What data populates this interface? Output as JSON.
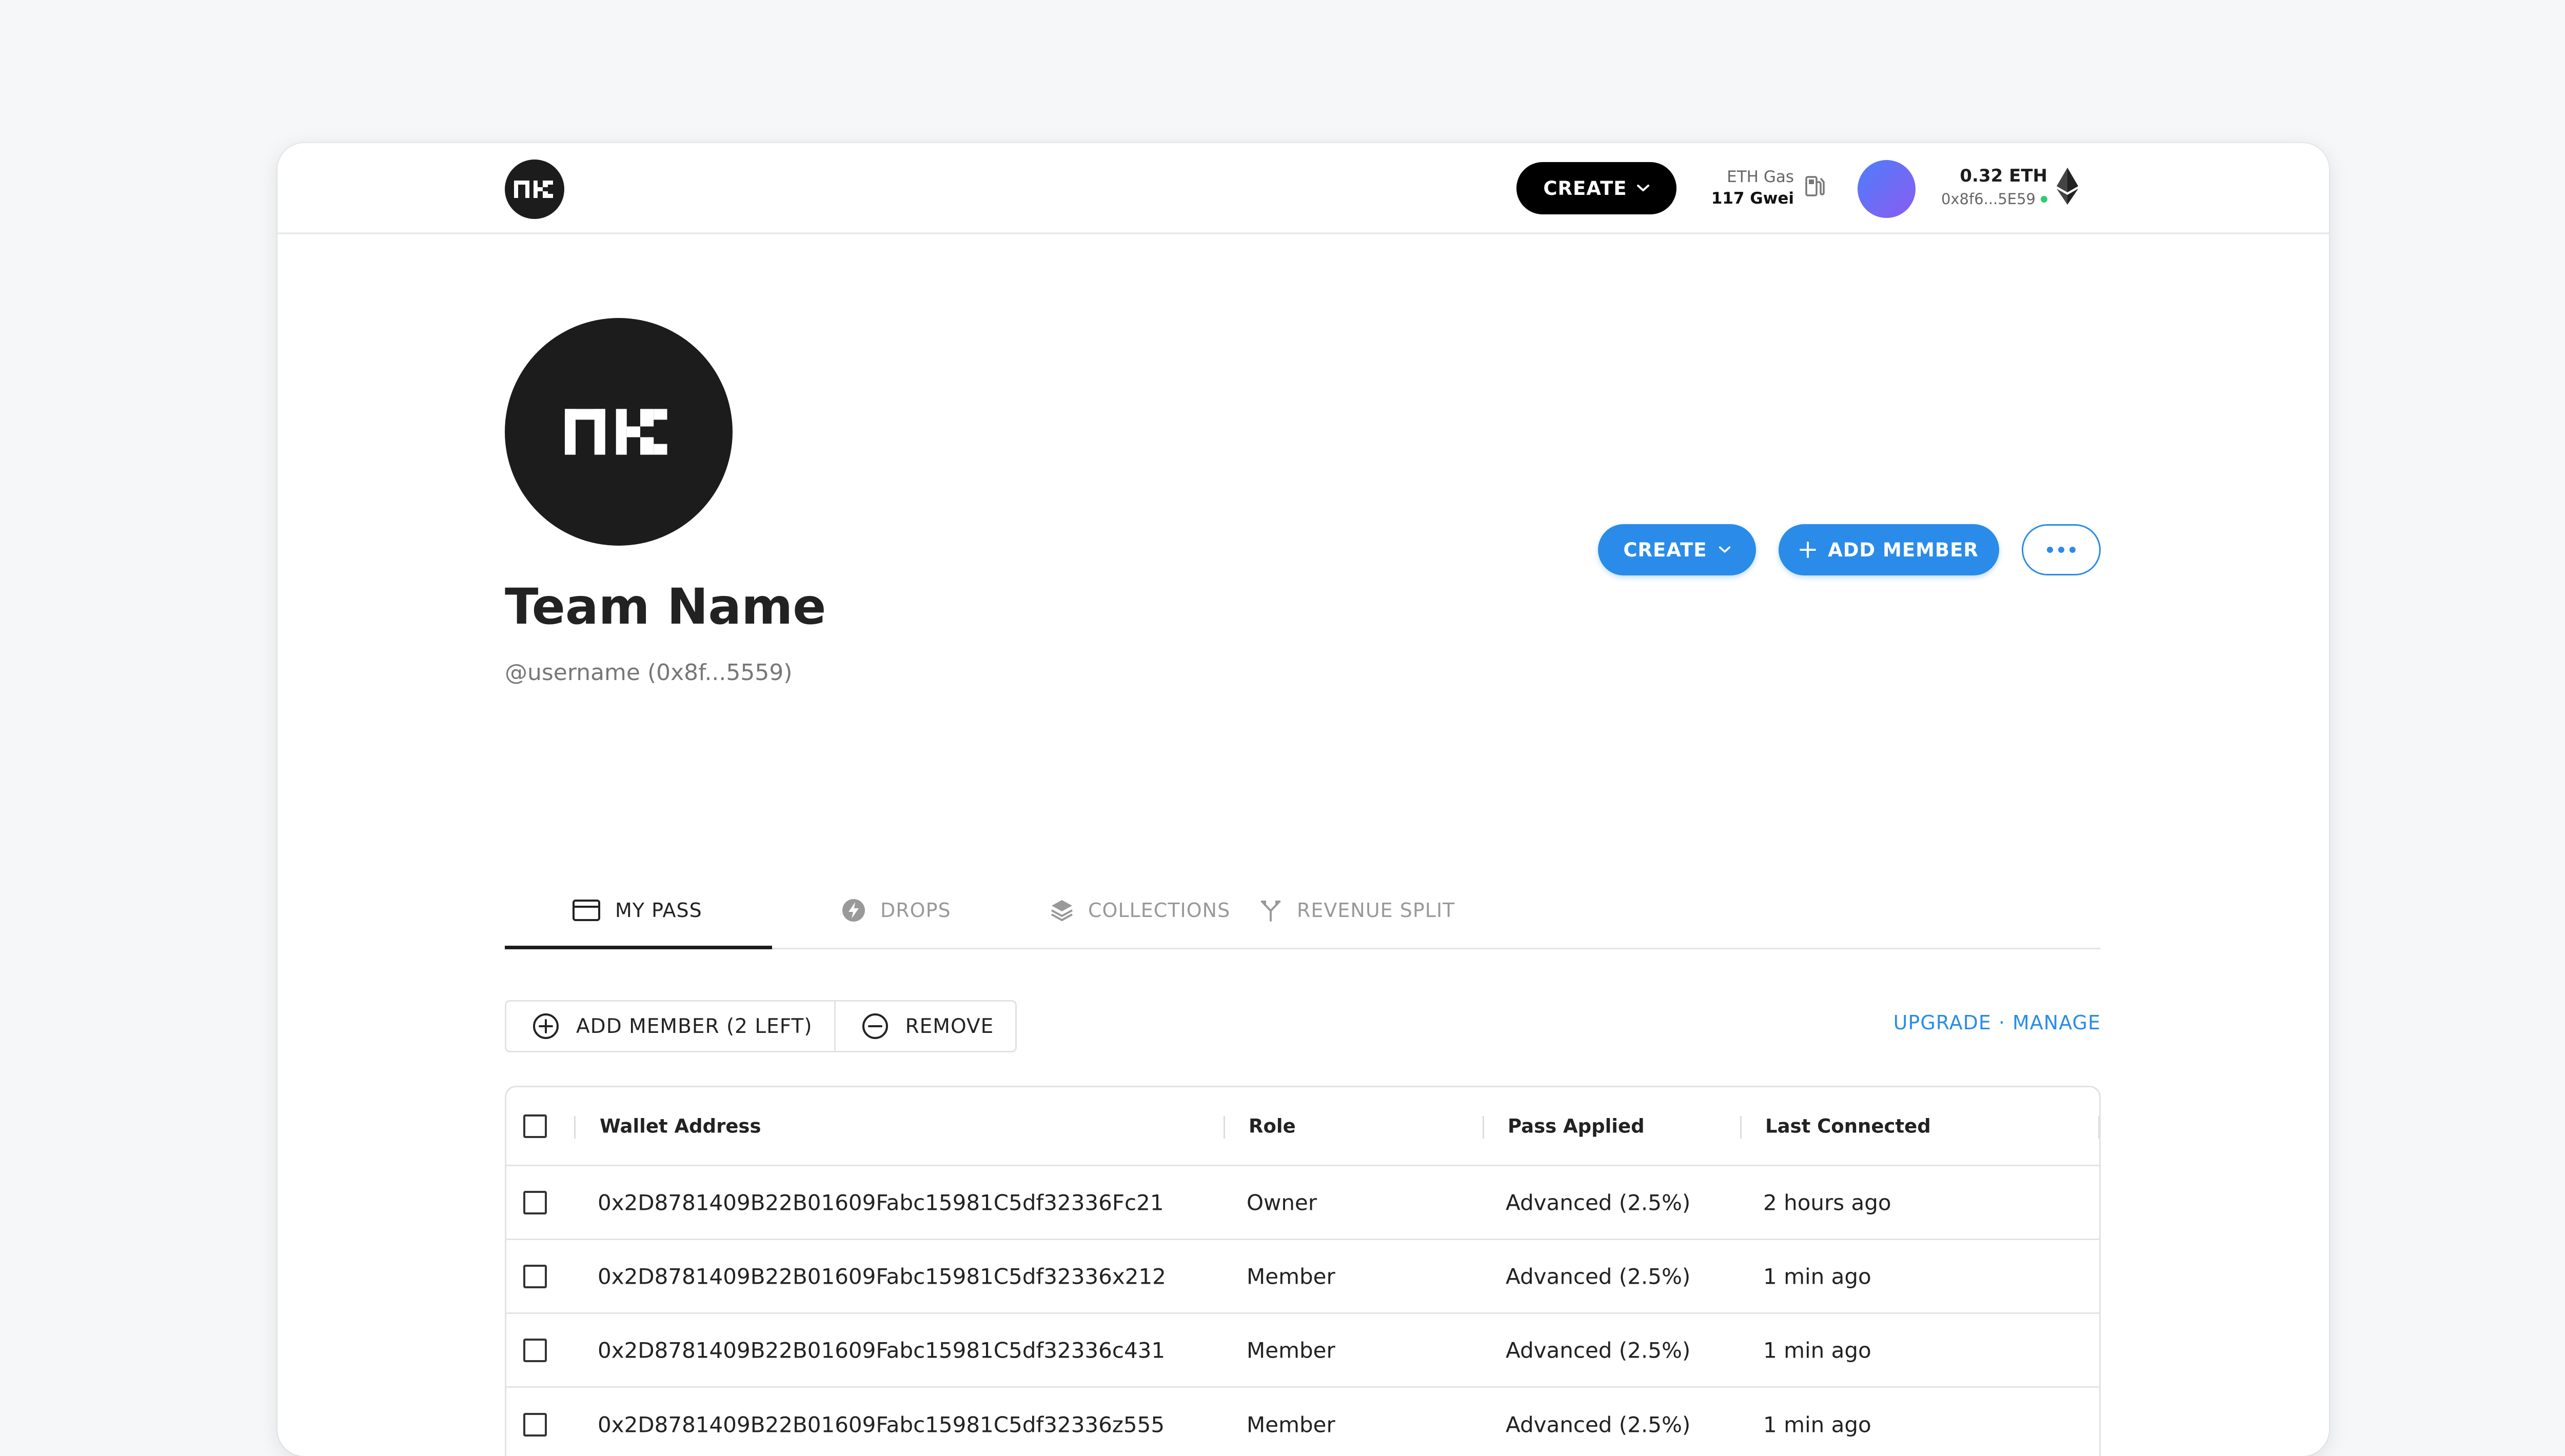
{
  "header": {
    "create_label": "CREATE",
    "gas_label": "ETH Gas",
    "gas_value": "117 Gwei",
    "balance": "0.32 ETH",
    "address": "0x8f6...5E59"
  },
  "profile": {
    "team_name": "Team Name",
    "username": "@username (0x8f...5559)",
    "create_label": "CREATE",
    "add_member_label": "ADD MEMBER"
  },
  "tabs": [
    {
      "label": "MY PASS",
      "icon": "card-icon",
      "active": true
    },
    {
      "label": "DROPS",
      "icon": "bolt-icon",
      "active": false
    },
    {
      "label": "COLLECTIONS",
      "icon": "layers-icon",
      "active": false
    },
    {
      "label": "REVENUE SPLIT",
      "icon": "split-icon",
      "active": false
    }
  ],
  "actions": {
    "add_member": "ADD MEMBER (2 LEFT)",
    "remove": "REMOVE",
    "upgrade": "UPGRADE",
    "separator": "·",
    "manage": "MANAGE"
  },
  "table": {
    "columns": [
      "Wallet Address",
      "Role",
      "Pass Applied",
      "Last Connected"
    ],
    "rows": [
      {
        "wallet": "0x2D8781409B22B01609Fabc15981C5df32336Fc21",
        "role": "Owner",
        "pass": "Advanced (2.5%)",
        "last": "2 hours ago"
      },
      {
        "wallet": "0x2D8781409B22B01609Fabc15981C5df32336x212",
        "role": "Member",
        "pass": "Advanced (2.5%)",
        "last": "1 min ago"
      },
      {
        "wallet": "0x2D8781409B22B01609Fabc15981C5df32336c431",
        "role": "Member",
        "pass": "Advanced (2.5%)",
        "last": "1 min ago"
      },
      {
        "wallet": "0x2D8781409B22B01609Fabc15981C5df32336z555",
        "role": "Member",
        "pass": "Advanced (2.5%)",
        "last": "1 min ago"
      }
    ]
  },
  "colors": {
    "accent": "#2a8ce8",
    "dark": "#1c1c1c",
    "status_online": "#2ecc71"
  }
}
